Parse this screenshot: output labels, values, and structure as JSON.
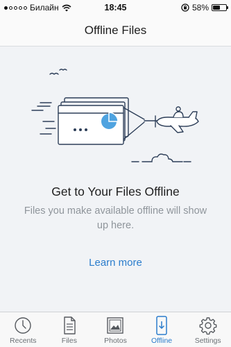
{
  "status_bar": {
    "carrier": "Билайн",
    "time": "18:45",
    "battery_percent": "58%",
    "battery_level": 0.58,
    "signal_bars_filled": 1,
    "signal_bars_total": 5,
    "icons": [
      "signal-dots-icon",
      "wifi-icon",
      "orientation-lock-icon",
      "battery-icon"
    ]
  },
  "nav": {
    "title": "Offline Files"
  },
  "empty_state": {
    "heading": "Get to Your Files Offline",
    "subtitle": "Files you make available offline will show up here.",
    "link": "Learn more",
    "illustration": "airplane-towing-file-banner"
  },
  "tabs": [
    {
      "id": "recents",
      "label": "Recents",
      "icon": "clock-icon",
      "active": false
    },
    {
      "id": "files",
      "label": "Files",
      "icon": "document-icon",
      "active": false
    },
    {
      "id": "photos",
      "label": "Photos",
      "icon": "photo-icon",
      "active": false
    },
    {
      "id": "offline",
      "label": "Offline",
      "icon": "phone-download-icon",
      "active": true
    },
    {
      "id": "settings",
      "label": "Settings",
      "icon": "gear-icon",
      "active": false
    }
  ],
  "colors": {
    "accent": "#2a7ccc",
    "background": "#f1f3f6",
    "subtitle": "#8f959b",
    "illustration_line": "#2d3e58",
    "illustration_pie": "#4fa3e0"
  }
}
